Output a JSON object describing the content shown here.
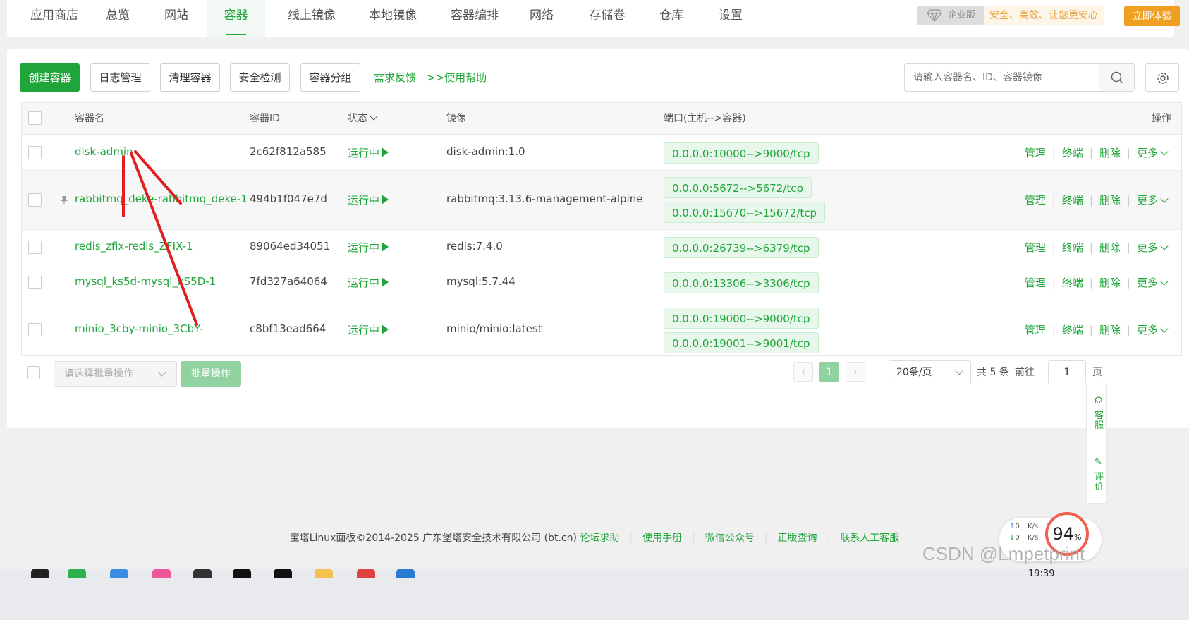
{
  "nav": {
    "tabs": [
      "应用商店",
      "总览",
      "网站",
      "容器",
      "线上镜像",
      "本地镜像",
      "容器编排",
      "网络",
      "存储卷",
      "仓库",
      "设置"
    ],
    "active_index": 3,
    "enterprise_label": "企业版",
    "slogan": "安全、高效、让您更安心",
    "try_button": "立即体验"
  },
  "toolbar": {
    "create": "创建容器",
    "logs": "日志管理",
    "clean": "清理容器",
    "security": "安全检测",
    "group": "容器分组",
    "feedback": "需求反馈",
    "help": ">>使用帮助",
    "search_placeholder": "请输入容器名、ID、容器镜像"
  },
  "table": {
    "headers": {
      "name": "容器名",
      "id": "容器ID",
      "status": "状态",
      "image": "镜像",
      "ports": "端口(主机-->容器)",
      "actions": "操作"
    },
    "rows": [
      {
        "name": "disk-admin",
        "id": "2c62f812a585",
        "status": "运行中",
        "image": "disk-admin:1.0",
        "ports": [
          "0.0.0.0:10000-->9000/tcp"
        ],
        "pinned": false
      },
      {
        "name": "rabbitmq_deke-rabbitmq_deke-1",
        "id": "494b1f047e7d",
        "status": "运行中",
        "image": "rabbitmq:3.13.6-management-alpine",
        "ports": [
          "0.0.0.0:5672-->5672/tcp",
          "0.0.0.0:15670-->15672/tcp"
        ],
        "pinned": true
      },
      {
        "name": "redis_zfix-redis_ZFIX-1",
        "id": "89064ed34051",
        "status": "运行中",
        "image": "redis:7.4.0",
        "ports": [
          "0.0.0.0:26739-->6379/tcp"
        ],
        "pinned": false
      },
      {
        "name": "mysql_ks5d-mysql_kS5D-1",
        "id": "7fd327a64064",
        "status": "运行中",
        "image": "mysql:5.7.44",
        "ports": [
          "0.0.0.0:13306-->3306/tcp"
        ],
        "pinned": false
      },
      {
        "name": "minio_3cby-minio_3CbY-",
        "id": "c8bf13ead664",
        "status": "运行中",
        "image": "minio/minio:latest",
        "ports": [
          "0.0.0.0:19000-->9000/tcp",
          "0.0.0.0:19001-->9001/tcp"
        ],
        "pinned": false
      }
    ],
    "actions": {
      "manage": "管理",
      "terminal": "终端",
      "delete": "删除",
      "more": "更多"
    }
  },
  "bottom": {
    "batch_placeholder": "请选择批量操作",
    "batch_button": "批量操作",
    "current_page": "1",
    "page_size": "20条/页",
    "total": "共 5 条",
    "goto_label": "前往",
    "goto_value": "1",
    "page_suffix": "页"
  },
  "footer": {
    "copyright": "宝塔Linux面板©2014-2025 广东堡塔安全技术有限公司 (bt.cn)",
    "links": [
      "论坛求助",
      "使用手册",
      "微信公众号",
      "正版查询",
      "联系人工客服"
    ]
  },
  "float": {
    "service": "客服",
    "review": "评价"
  },
  "speed": {
    "up": "0",
    "down": "0",
    "unit": "K/s",
    "percent": "94",
    "percent_sign": "%"
  },
  "watermark": "CSDN @Lmpetprint",
  "clock": "19:39",
  "colors": {
    "accent": "#20a53a",
    "annotation": "#e02020",
    "try_button": "#f0a020"
  }
}
